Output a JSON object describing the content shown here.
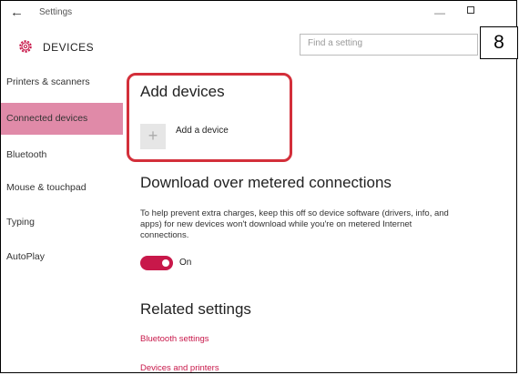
{
  "window": {
    "title": "Settings",
    "back_icon": "arrow-left-icon",
    "minimize_glyph": "—",
    "page_badge": "8"
  },
  "header": {
    "section_icon": "gear-icon",
    "section_title": "DEVICES",
    "search_placeholder": "Find a setting"
  },
  "sidebar": {
    "items": [
      {
        "label": "Printers & scanners",
        "active": false
      },
      {
        "label": "Connected devices",
        "active": true
      },
      {
        "label": "Bluetooth",
        "active": false
      },
      {
        "label": "Mouse & touchpad",
        "active": false
      },
      {
        "label": "Typing",
        "active": false
      },
      {
        "label": "AutoPlay",
        "active": false
      }
    ]
  },
  "main": {
    "add_devices_heading": "Add devices",
    "add_device_icon": "plus-icon",
    "add_device_label": "Add a device",
    "download_heading": "Download over metered connections",
    "download_description": "To help prevent extra charges, keep this off so device software (drivers, info, and apps) for new devices won't download while you're on metered Internet connections.",
    "toggle_state": "On",
    "related_heading": "Related settings",
    "related_links": [
      "Bluetooth settings",
      "Devices and printers"
    ]
  },
  "colors": {
    "accent": "#c8184a",
    "sidebar_active": "#e08aa8",
    "highlight_outline": "#d32f3a"
  }
}
